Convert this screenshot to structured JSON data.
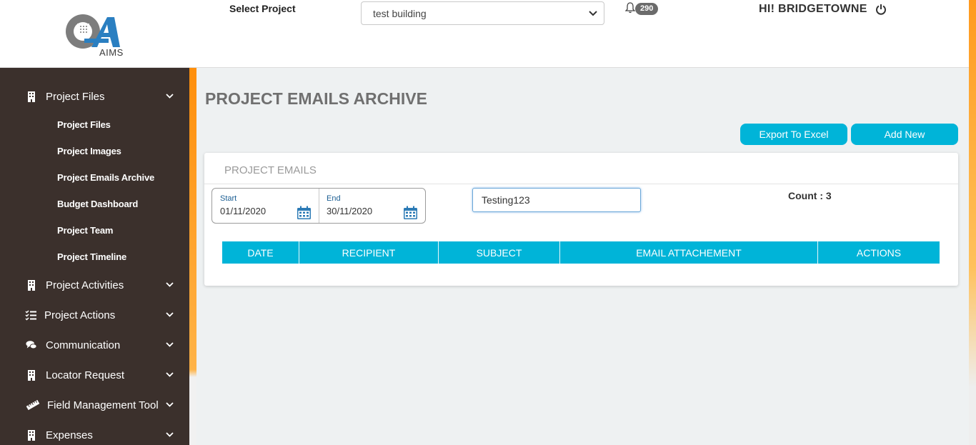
{
  "header": {
    "logo_text": "AIMS",
    "select_label": "Select Project",
    "selected_project": "test building",
    "notification_count": "290",
    "greeting": "HI! BRIDGETOWNE",
    "icons": {
      "bell": "bell-icon",
      "power": "power-icon",
      "chevron": "chevron-down-icon"
    }
  },
  "sidebar": {
    "groups": [
      {
        "label": "Project Files",
        "icon": "building-icon"
      },
      {
        "label": "Project Activities",
        "icon": "building-icon"
      },
      {
        "label": "Project Actions",
        "icon": "list-check-icon"
      },
      {
        "label": "Communication",
        "icon": "chat-icon"
      },
      {
        "label": "Locator Request",
        "icon": "building-icon"
      },
      {
        "label": "Field Management Tool",
        "icon": "ruler-icon"
      },
      {
        "label": "Expenses",
        "icon": "building-icon"
      }
    ],
    "project_files_items": [
      {
        "label": "Project Files"
      },
      {
        "label": "Project Images"
      },
      {
        "label": "Project Emails Archive"
      },
      {
        "label": "Budget Dashboard"
      },
      {
        "label": "Project Team"
      },
      {
        "label": "Project Timeline"
      }
    ]
  },
  "main": {
    "title": "PROJECT EMAILS ARCHIVE",
    "export_button": "Export To Excel",
    "add_button": "Add New",
    "card_title": "PROJECT EMAILS",
    "start_label": "Start",
    "start_value": "01/11/2020",
    "end_label": "End",
    "end_value": "30/11/2020",
    "search_value": "Testing123",
    "count_text": "Count : 3",
    "table_headers": [
      "DATE",
      "RECIPIENT",
      "SUBJECT",
      "EMAIL ATTACHEMENT",
      "ACTIONS"
    ]
  },
  "colors": {
    "accent": "#00b4d8",
    "sidebar_bg": "#3b302c",
    "stripe_orange": "#ff8f0c"
  }
}
